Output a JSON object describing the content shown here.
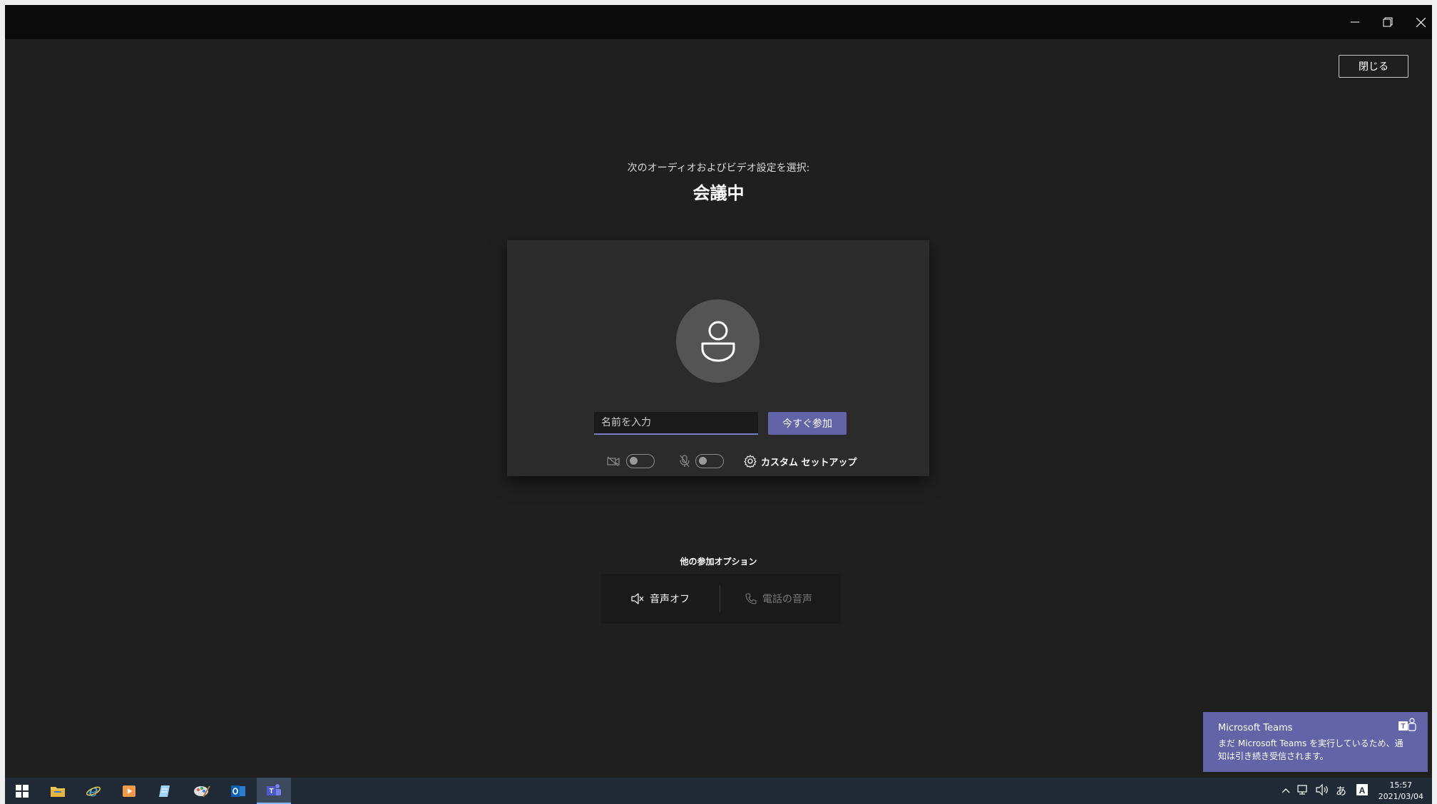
{
  "window": {
    "controls": [
      "minimize-icon",
      "restore-icon",
      "close-icon"
    ]
  },
  "header": {
    "close_label": "閉じる",
    "subtitle": "次のオーディオおよびビデオ設定を選択:",
    "meeting_title": "会議中"
  },
  "prejoin": {
    "avatar_icon": "person-icon",
    "name_placeholder": "名前を入力",
    "name_value": "",
    "join_label": "今すぐ参加",
    "camera_icon": "camera-off-icon",
    "camera_on": false,
    "mic_icon": "mic-off-icon",
    "mic_on": false,
    "custom_setup_label": "カスタム セットアップ"
  },
  "other_options": {
    "label": "他の参加オプション",
    "audio_off_label": "音声オフ",
    "phone_audio_label": "電話の音声"
  },
  "toast": {
    "title": "Microsoft Teams",
    "body": "まだ Microsoft Teams を実行しているため、通知は引き続き受信されます。"
  },
  "taskbar": {
    "apps": [
      "windows-start-icon",
      "file-explorer-icon",
      "internet-explorer-icon",
      "media-player-icon",
      "notes-icon",
      "paint-icon",
      "outlook-icon",
      "teams-icon"
    ],
    "active_app": "teams-icon",
    "ime_label": "あ",
    "time": "15:57",
    "date": "2021/03/04"
  },
  "colors": {
    "accent": "#6264a7",
    "background": "#1f1f1f",
    "card": "#2b2b2b"
  }
}
